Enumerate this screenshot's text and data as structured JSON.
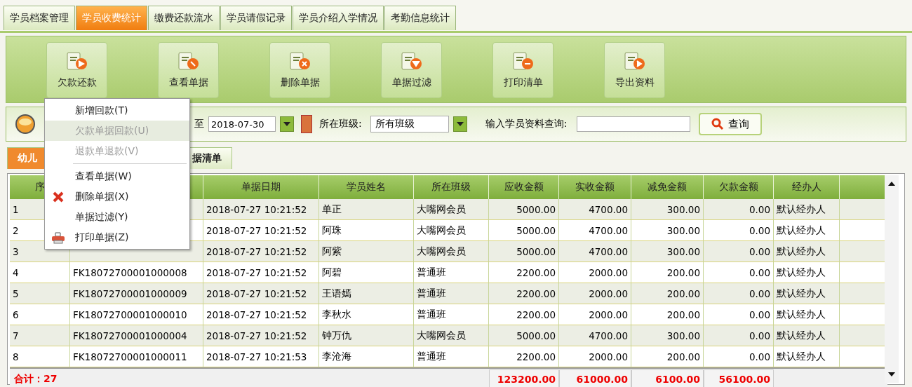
{
  "tabs": [
    {
      "label": "学员档案管理",
      "selected": false
    },
    {
      "label": "学员收费统计",
      "selected": true
    },
    {
      "label": "缴费还款流水",
      "selected": false
    },
    {
      "label": "学员请假记录",
      "selected": false
    },
    {
      "label": "学员介绍入学情况",
      "selected": false
    },
    {
      "label": "考勤信息统计",
      "selected": false
    }
  ],
  "toolbar": [
    {
      "label": "欠款还款",
      "kind": "arrow"
    },
    {
      "label": "查看单据",
      "kind": "view"
    },
    {
      "label": "删除单据",
      "kind": "delete"
    },
    {
      "label": "单据过滤",
      "kind": "filter"
    },
    {
      "label": "打印清单",
      "kind": "print"
    },
    {
      "label": "导出资料",
      "kind": "export"
    }
  ],
  "filter": {
    "to_label": "至",
    "date_to": "2018-07-30",
    "class_label": "所在班级:",
    "class_value": "所有班级",
    "search_label": "输入学员资料查询:",
    "search_button": "查询"
  },
  "subtabs": [
    {
      "label": "幼儿",
      "selected": true
    },
    {
      "label": "据清单",
      "selected": false
    }
  ],
  "table": {
    "columns": [
      "序",
      "",
      "单据日期",
      "学员姓名",
      "所在班级",
      "应收金额",
      "实收金额",
      "减免金额",
      "欠款金额",
      "经办人"
    ],
    "rows": [
      {
        "no": "1",
        "id": "",
        "date": "2018-07-27 10:21:52",
        "name": "单正",
        "class": "大嘴网会员",
        "due": "5000.00",
        "paid": "4700.00",
        "discount": "300.00",
        "owed": "0.00",
        "handler": "默认经办人"
      },
      {
        "no": "2",
        "id": "",
        "date": "2018-07-27 10:21:52",
        "name": "阿珠",
        "class": "大嘴网会员",
        "due": "5000.00",
        "paid": "4700.00",
        "discount": "300.00",
        "owed": "0.00",
        "handler": "默认经办人"
      },
      {
        "no": "3",
        "id": "",
        "date": "2018-07-27 10:21:52",
        "name": "阿紫",
        "class": "大嘴网会员",
        "due": "5000.00",
        "paid": "4700.00",
        "discount": "300.00",
        "owed": "0.00",
        "handler": "默认经办人"
      },
      {
        "no": "4",
        "id": "FK18072700001000008",
        "date": "2018-07-27 10:21:52",
        "name": "阿碧",
        "class": "普通班",
        "due": "2200.00",
        "paid": "2000.00",
        "discount": "200.00",
        "owed": "0.00",
        "handler": "默认经办人"
      },
      {
        "no": "5",
        "id": "FK18072700001000009",
        "date": "2018-07-27 10:21:52",
        "name": "王语嫣",
        "class": "普通班",
        "due": "2200.00",
        "paid": "2000.00",
        "discount": "200.00",
        "owed": "0.00",
        "handler": "默认经办人"
      },
      {
        "no": "6",
        "id": "FK18072700001000010",
        "date": "2018-07-27 10:21:52",
        "name": "李秋水",
        "class": "普通班",
        "due": "2200.00",
        "paid": "2000.00",
        "discount": "200.00",
        "owed": "0.00",
        "handler": "默认经办人"
      },
      {
        "no": "7",
        "id": "FK18072700001000004",
        "date": "2018-07-27 10:21:52",
        "name": "钟万仇",
        "class": "大嘴网会员",
        "due": "5000.00",
        "paid": "4700.00",
        "discount": "300.00",
        "owed": "0.00",
        "handler": "默认经办人"
      },
      {
        "no": "8",
        "id": "FK18072700001000011",
        "date": "2018-07-27 10:21:53",
        "name": "李沧海",
        "class": "普通班",
        "due": "2200.00",
        "paid": "2000.00",
        "discount": "200.00",
        "owed": "0.00",
        "handler": "默认经办人"
      }
    ],
    "total_label": "合计：27",
    "totals": [
      "123200.00",
      "61000.00",
      "6100.00",
      "56100.00"
    ]
  },
  "context_menu": [
    {
      "kind": "item",
      "label": "新增回款(T)",
      "disabled": false,
      "selected": false
    },
    {
      "kind": "item",
      "label": "欠款单据回款(U)",
      "disabled": true,
      "selected": true
    },
    {
      "kind": "item",
      "label": "退款单退款(V)",
      "disabled": true,
      "selected": false
    },
    {
      "kind": "separator"
    },
    {
      "kind": "item",
      "label": "查看单据(W)",
      "disabled": false,
      "selected": false
    },
    {
      "kind": "delete",
      "label": "删除单据(X)",
      "disabled": false,
      "selected": false
    },
    {
      "kind": "item",
      "label": "单据过滤(Y)",
      "disabled": false,
      "selected": false
    },
    {
      "kind": "print",
      "label": "打印单据(Z)",
      "disabled": false,
      "selected": false
    }
  ]
}
